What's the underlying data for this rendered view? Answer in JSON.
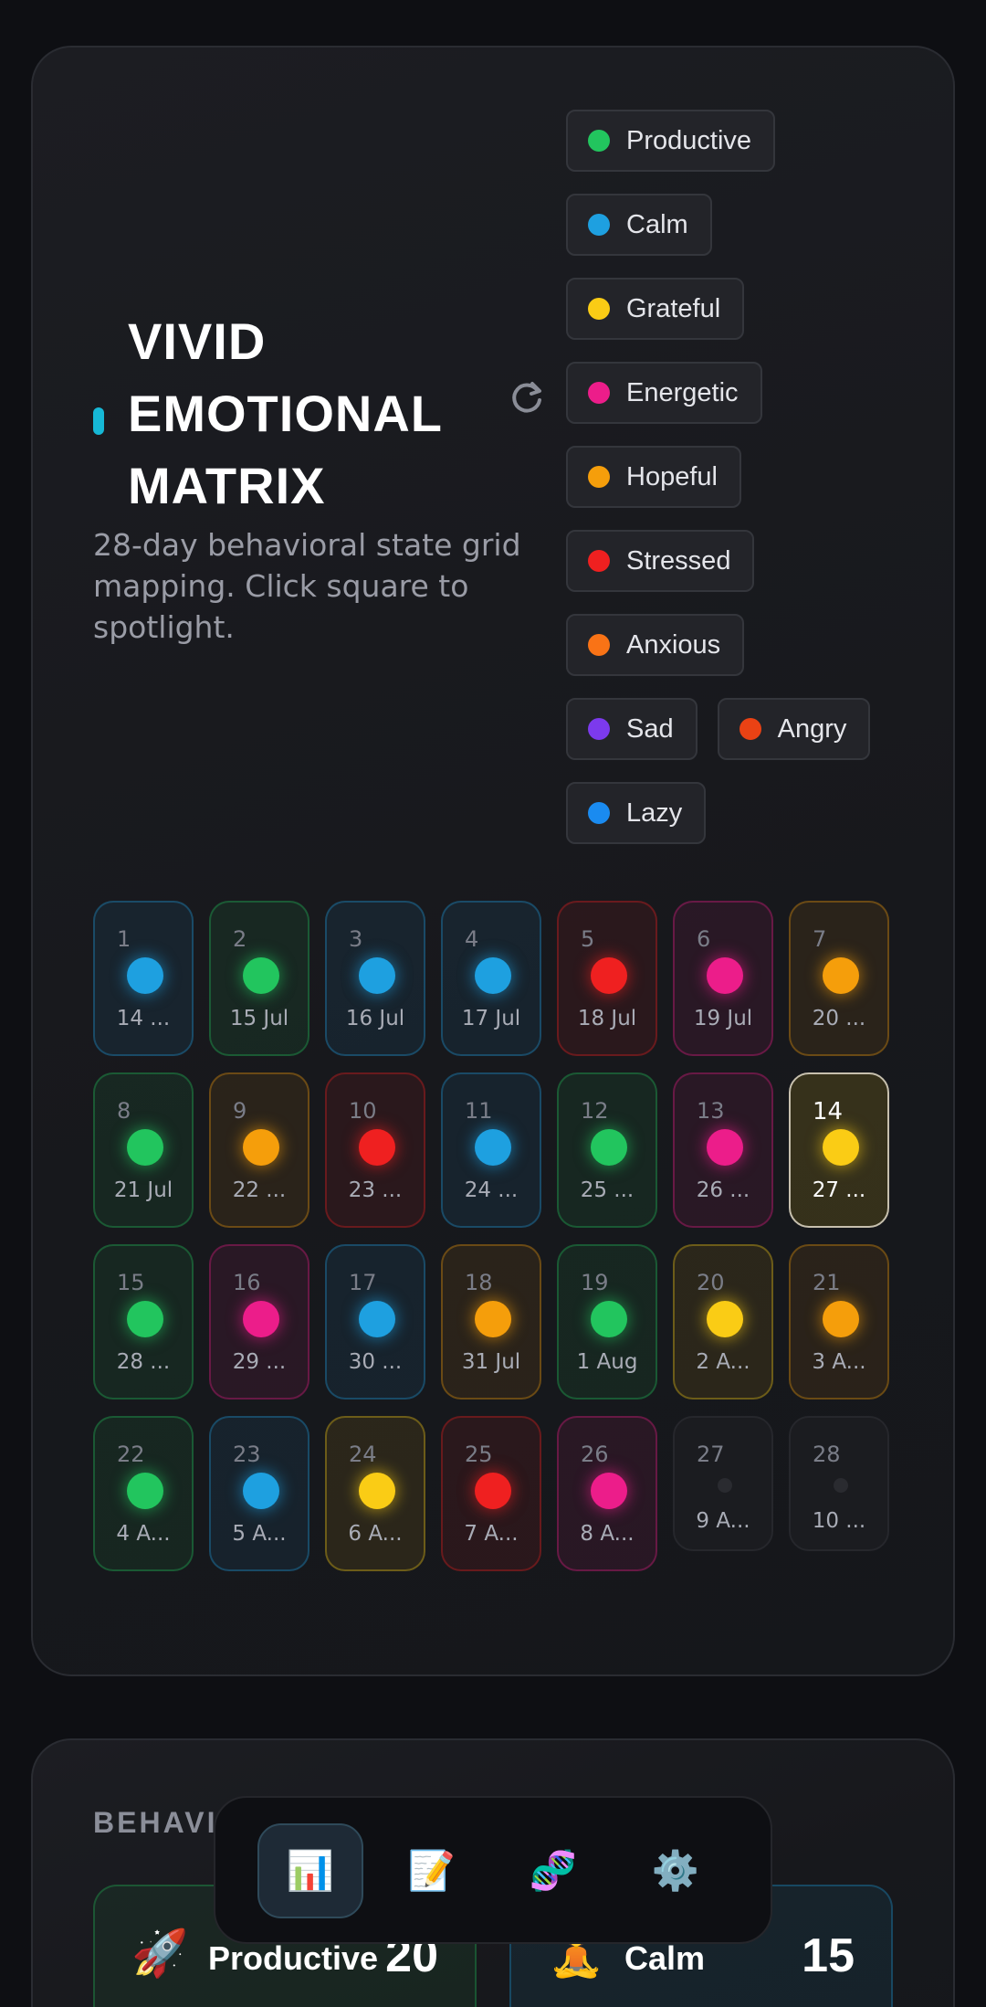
{
  "header": {
    "title_lines": [
      "VIVID",
      "EMOTIONAL",
      "MATRIX"
    ],
    "subtitle": "28-day behavioral state grid mapping. Click square to spotlight.",
    "refresh_icon": "refresh-icon"
  },
  "legend": [
    [
      {
        "label": "Productive",
        "color": "#22c55e"
      }
    ],
    [
      {
        "label": "Calm",
        "color": "#1ea0e0"
      }
    ],
    [
      {
        "label": "Grateful",
        "color": "#facc15"
      }
    ],
    [
      {
        "label": "Energetic",
        "color": "#ec1d8a"
      }
    ],
    [
      {
        "label": "Hopeful",
        "color": "#f59e0b"
      }
    ],
    [
      {
        "label": "Stressed",
        "color": "#ef2020"
      }
    ],
    [
      {
        "label": "Anxious",
        "color": "#f97316"
      }
    ],
    [
      {
        "label": "Sad",
        "color": "#7c3aed"
      },
      {
        "label": "Angry",
        "color": "#ea4214"
      }
    ],
    [
      {
        "label": "Lazy",
        "color": "#1a8bf0"
      }
    ]
  ],
  "grid": {
    "selected": 14,
    "cells": [
      {
        "num": "1",
        "date": "14 ...",
        "mood": "Calm"
      },
      {
        "num": "2",
        "date": "15 Jul",
        "mood": "Productive"
      },
      {
        "num": "3",
        "date": "16 Jul",
        "mood": "Calm"
      },
      {
        "num": "4",
        "date": "17 Jul",
        "mood": "Calm"
      },
      {
        "num": "5",
        "date": "18 Jul",
        "mood": "Stressed"
      },
      {
        "num": "6",
        "date": "19 Jul",
        "mood": "Energetic"
      },
      {
        "num": "7",
        "date": "20 ...",
        "mood": "Hopeful"
      },
      {
        "num": "8",
        "date": "21 Jul",
        "mood": "Productive"
      },
      {
        "num": "9",
        "date": "22 ...",
        "mood": "Hopeful"
      },
      {
        "num": "10",
        "date": "23 ...",
        "mood": "Stressed"
      },
      {
        "num": "11",
        "date": "24 ...",
        "mood": "Calm"
      },
      {
        "num": "12",
        "date": "25 ...",
        "mood": "Productive"
      },
      {
        "num": "13",
        "date": "26 ...",
        "mood": "Energetic"
      },
      {
        "num": "14",
        "date": "27 ...",
        "mood": "Grateful"
      },
      {
        "num": "15",
        "date": "28 ...",
        "mood": "Productive"
      },
      {
        "num": "16",
        "date": "29 ...",
        "mood": "Energetic"
      },
      {
        "num": "17",
        "date": "30 ...",
        "mood": "Calm"
      },
      {
        "num": "18",
        "date": "31 Jul",
        "mood": "Hopeful"
      },
      {
        "num": "19",
        "date": "1 Aug",
        "mood": "Productive"
      },
      {
        "num": "20",
        "date": "2 A...",
        "mood": "Grateful"
      },
      {
        "num": "21",
        "date": "3 A...",
        "mood": "Hopeful"
      },
      {
        "num": "22",
        "date": "4 A...",
        "mood": "Productive"
      },
      {
        "num": "23",
        "date": "5 A...",
        "mood": "Calm"
      },
      {
        "num": "24",
        "date": "6 A...",
        "mood": "Grateful"
      },
      {
        "num": "25",
        "date": "7 A...",
        "mood": "Stressed"
      },
      {
        "num": "26",
        "date": "8 A...",
        "mood": "Energetic"
      },
      {
        "num": "27",
        "date": "9 A...",
        "mood": null
      },
      {
        "num": "28",
        "date": "10 ...",
        "mood": null
      }
    ]
  },
  "summary": {
    "title": "BEHAVI",
    "stats": [
      {
        "emoji": "🚀",
        "label": "Productive",
        "value": "20",
        "color": "#22c55e"
      },
      {
        "emoji": "🧘",
        "label": "Calm",
        "value": "15",
        "color": "#1ea0e0"
      }
    ]
  },
  "nav": [
    {
      "name": "stats-tab",
      "icon": "📊",
      "active": true
    },
    {
      "name": "journal-tab",
      "icon": "📝",
      "active": false
    },
    {
      "name": "dna-tab",
      "icon": "🧬",
      "active": false
    },
    {
      "name": "settings-tab",
      "icon": "⚙️",
      "active": false
    }
  ]
}
